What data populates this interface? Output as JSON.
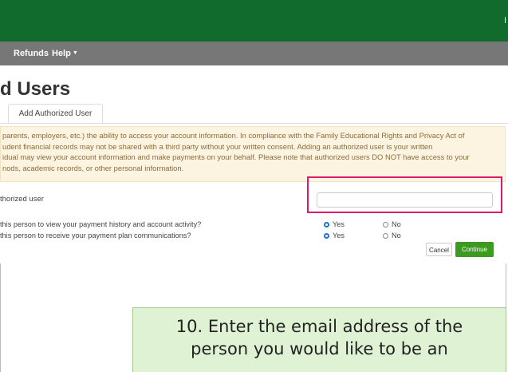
{
  "header": {
    "right_fragment": "I"
  },
  "nav": {
    "refunds": "Refunds",
    "help": "Help"
  },
  "page": {
    "title": "d Users",
    "tab_label": "Add Authorized User"
  },
  "notice_lines": [
    "parents, employers, etc.) the ability to access your account information. In compliance with the Family Educational Rights and Privacy Act of",
    "udent financial records may not be shared with a third party without your written consent. Adding an authorized user is your written",
    "idual may view your account information and make payments on your behalf. Please note that authorized users DO NOT have access to your",
    "nods, academic records, or other personal information."
  ],
  "form": {
    "email_label": "thorized user",
    "email_value": "",
    "q1": "this person to view your payment history and account activity?",
    "q2": "this person to receive your payment plan communications?",
    "yes": "Yes",
    "no": "No",
    "q1_selected": "Yes",
    "q2_selected": "Yes",
    "cancel": "Cancel",
    "continue": "Continue"
  },
  "callout": {
    "line1": "10. Enter the email address of the",
    "line2": "person you would like to be an"
  },
  "colors": {
    "header_green": "#116b2c",
    "nav_gray": "#777777",
    "highlight": "#e0196b",
    "continue_green": "#3d9a20",
    "callout_bg": "#dff2d4"
  }
}
